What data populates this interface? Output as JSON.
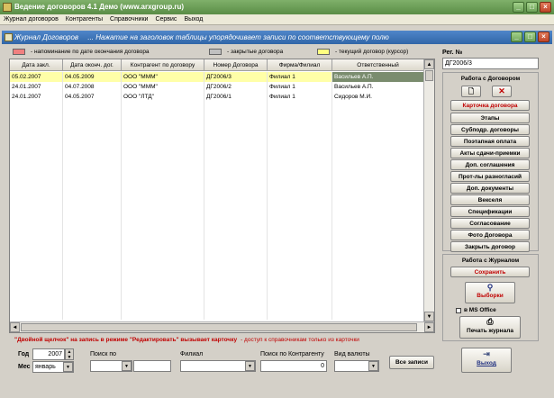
{
  "window": {
    "title": "Ведение договоров 4.1 Демо (www.arxgroup.ru)"
  },
  "menu": [
    "Журнал договоров",
    "Контрагенты",
    "Справочники",
    "Сервис",
    "Выход"
  ],
  "subwindow": {
    "title": "Журнал Договоров",
    "hint": "...  Нажатие на заголовок таблицы упорядочивает записи по соответствующему полю"
  },
  "legend": [
    {
      "color": "#f08080",
      "label": "- напоминание по дате окончания договора"
    },
    {
      "color": "#c0c0c0",
      "label": "- закрытые договора"
    },
    {
      "color": "#ffff80",
      "label": "- текущий договор (курсор)"
    }
  ],
  "table": {
    "columns": [
      "Дата закл.",
      "Дата оконч. дог.",
      "Контрагент по договору",
      "Номер Договора",
      "Фирма/Филиал",
      "Ответственный"
    ],
    "rows": [
      [
        "05.02.2007",
        "04.05.2009",
        "ООО \"МММ\"",
        "ДГ2006/3",
        "Филиал 1",
        "Васильев А.П."
      ],
      [
        "24.01.2007",
        "04.07.2008",
        "ООО \"МММ\"",
        "ДГ2006/2",
        "Филиал 1",
        "Васильев А.П."
      ],
      [
        "24.01.2007",
        "04.05.2007",
        "ООО \"ЛТД\"",
        "ДГ2006/1",
        "Филиал 1",
        "Сидоров М.И."
      ]
    ]
  },
  "footer_hint": {
    "part1": "\"Двойной щелчок\" на запись в режиме \"Редактировать\" вызывает карточку",
    "part2": "-  доступ к справочникам только из карточки"
  },
  "filters": {
    "year_label": "Год",
    "year_value": "2007",
    "month_label": "Мес",
    "month_value": "январь",
    "search_label": "Поиск по",
    "branch_label": "Филиал",
    "contractor_search_label": "Поиск по Контрагенту",
    "contractor_search_value": "0",
    "currency_label": "Вид валюты",
    "all_records_button": "Все записи"
  },
  "right_panel": {
    "reg_label": "Рег. №",
    "reg_value": "ДГ2006/3",
    "contract_section": "Работа с Договором",
    "contract_buttons": [
      "Карточка договора",
      "Этапы",
      "Субподр. договоры",
      "Поэтапная оплата",
      "Акты сдачи-приемки",
      "Доп. соглашения",
      "Прот-лы разногласий",
      "Доп. документы",
      "Векселя",
      "Спецификации",
      "Согласование",
      "Фото Договора",
      "Закрыть договор"
    ],
    "journal_section": "Работа с Журналом",
    "save_button": "Сохранить",
    "select_button": "Выборки",
    "ms_office_label": "в MS Office",
    "print_button": "Печать журнала",
    "exit_button": "Выход"
  },
  "colors": {
    "reminder": "#f08080",
    "closed": "#c0c0c0",
    "current": "#ffff80",
    "title_green": "#5a8d46",
    "title_blue": "#3166a8"
  }
}
